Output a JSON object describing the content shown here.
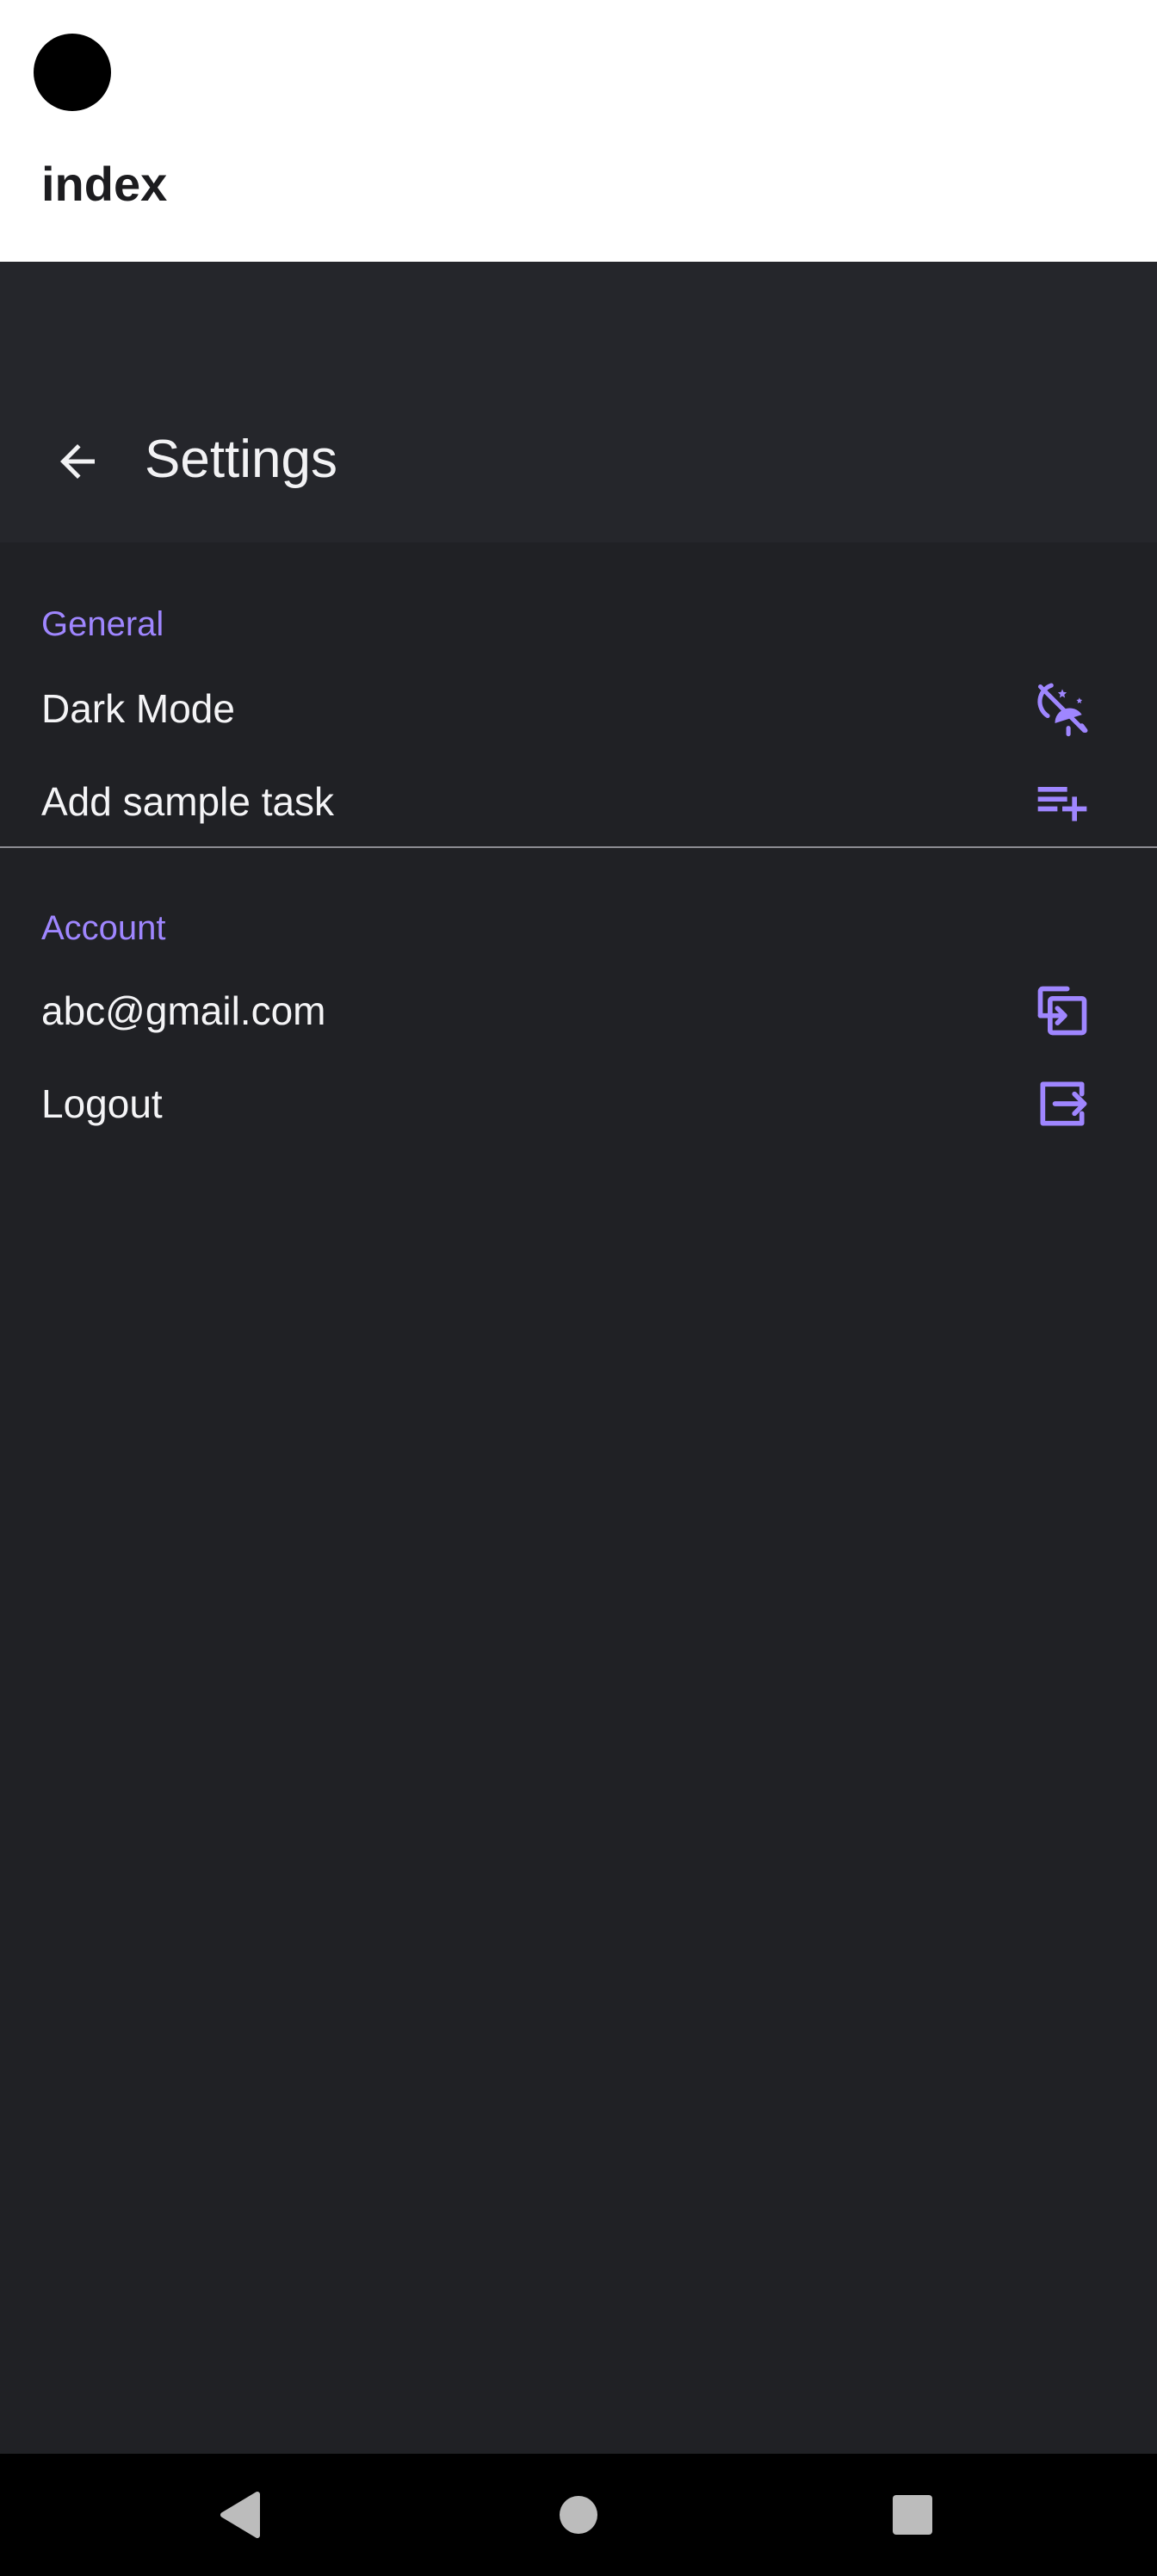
{
  "page": {
    "title": "index"
  },
  "appbar": {
    "title": "Settings",
    "back_icon": "arrow-left-icon"
  },
  "sections": [
    {
      "header": "General",
      "items": [
        {
          "label": "Dark Mode",
          "icon": "theme-toggle-icon"
        },
        {
          "label": "Add sample task",
          "icon": "playlist-add-icon"
        }
      ]
    },
    {
      "header": "Account",
      "items": [
        {
          "label": "abc@gmail.com",
          "icon": "account-switch-icon"
        },
        {
          "label": "Logout",
          "icon": "logout-icon"
        }
      ]
    }
  ],
  "nav": {
    "back": "triangle-back-icon",
    "home": "circle-home-icon",
    "recents": "square-recents-icon"
  },
  "colors": {
    "background": "#202125",
    "appbar": "#25262b",
    "accent": "#9f86ff",
    "text": "#f4f4f6",
    "status_bar": "#ffffff",
    "nav_bar": "#000000"
  }
}
